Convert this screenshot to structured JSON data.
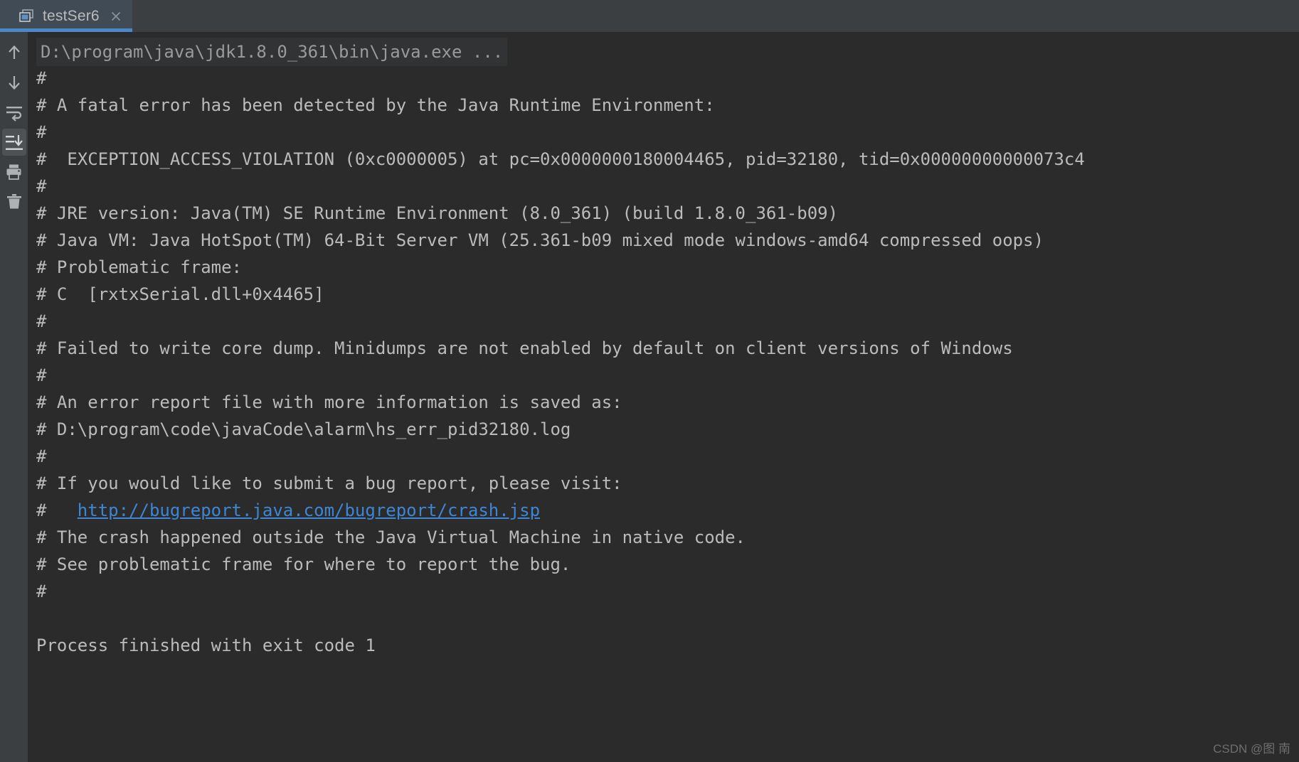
{
  "tab": {
    "label": "testSer6",
    "icon": "run-configuration-icon",
    "close_icon": "close-icon",
    "accent_color": "#4a88c7"
  },
  "gutter": {
    "buttons": [
      {
        "name": "up-arrow-icon",
        "label": "Up the Stack Trace",
        "active": false
      },
      {
        "name": "down-arrow-icon",
        "label": "Down the Stack Trace",
        "active": false
      },
      {
        "name": "soft-wrap-icon",
        "label": "Soft-Wrap",
        "active": false
      },
      {
        "name": "scroll-to-end-icon",
        "label": "Scroll to End",
        "active": true
      },
      {
        "name": "print-icon",
        "label": "Print",
        "active": false
      },
      {
        "name": "trash-icon",
        "label": "Clear All",
        "active": false
      }
    ]
  },
  "console": {
    "command": "D:\\program\\java\\jdk1.8.0_361\\bin\\java.exe ...",
    "lines": [
      "#",
      "# A fatal error has been detected by the Java Runtime Environment:",
      "#",
      "#  EXCEPTION_ACCESS_VIOLATION (0xc0000005) at pc=0x0000000180004465, pid=32180, tid=0x00000000000073c4",
      "#",
      "# JRE version: Java(TM) SE Runtime Environment (8.0_361) (build 1.8.0_361-b09)",
      "# Java VM: Java HotSpot(TM) 64-Bit Server VM (25.361-b09 mixed mode windows-amd64 compressed oops)",
      "# Problematic frame:",
      "# C  [rxtxSerial.dll+0x4465]",
      "#",
      "# Failed to write core dump. Minidumps are not enabled by default on client versions of Windows",
      "#",
      "# An error report file with more information is saved as:",
      "# D:\\program\\code\\javaCode\\alarm\\hs_err_pid32180.log",
      "#",
      "# If you would like to submit a bug report, please visit:",
      "#   __LINK__",
      "# The crash happened outside the Java Virtual Machine in native code.",
      "# See problematic frame for where to report the bug.",
      "#",
      "",
      "Process finished with exit code 1"
    ],
    "link_text": "http://bugreport.java.com/bugreport/crash.jsp",
    "link_color": "#3e86d4",
    "text_color": "#bbbbbb",
    "background_color": "#2b2b2b"
  },
  "watermark": {
    "text": "CSDN @图 南"
  }
}
